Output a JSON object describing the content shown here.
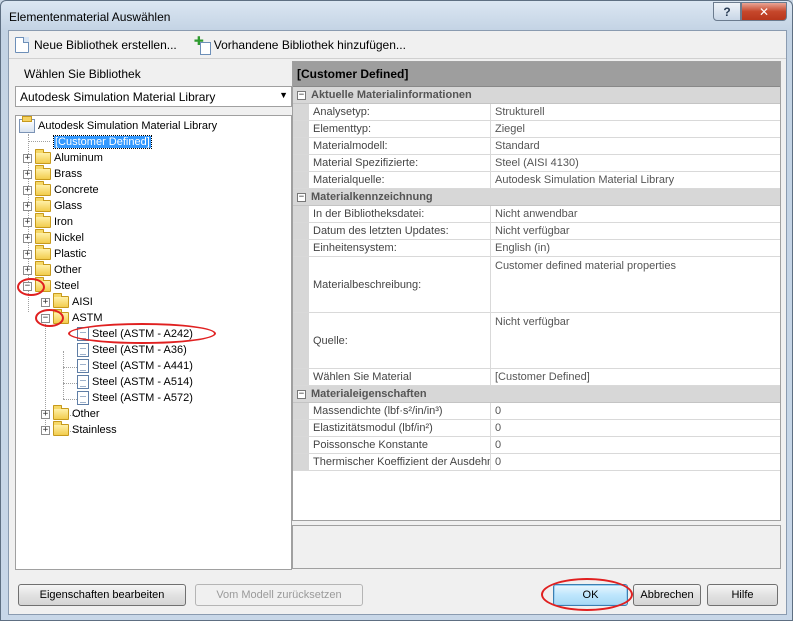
{
  "window": {
    "title": "Elementenmaterial Auswählen",
    "help": "?",
    "close": "✕"
  },
  "toolbar": {
    "new_library": "Neue Bibliothek erstellen...",
    "add_library": "Vorhandene Bibliothek hinzufügen..."
  },
  "library": {
    "label": "Wählen Sie Bibliothek",
    "selected": "Autodesk Simulation Material Library"
  },
  "tree": {
    "root": "Autodesk Simulation Material Library",
    "custom": "[Customer Defined]",
    "folders": [
      "Aluminum",
      "Brass",
      "Concrete",
      "Glass",
      "Iron",
      "Nickel",
      "Plastic",
      "Other",
      "Steel"
    ],
    "steel_children": {
      "aisi": "AISI",
      "astm": "ASTM",
      "other": "Other",
      "stainless": "Stainless"
    },
    "astm_items": [
      "Steel (ASTM - A242)",
      "Steel (ASTM - A36)",
      "Steel (ASTM - A441)",
      "Steel (ASTM - A514)",
      "Steel (ASTM - A572)"
    ]
  },
  "properties": {
    "header": "[Customer Defined]",
    "cat1": "Aktuelle Materialinformationen",
    "cat1_rows": [
      {
        "k": "Analysetyp:",
        "v": "Strukturell"
      },
      {
        "k": "Elementtyp:",
        "v": "Ziegel"
      },
      {
        "k": "Materialmodell:",
        "v": "Standard"
      },
      {
        "k": "Material Spezifizierte:",
        "v": "Steel (AISI 4130)"
      },
      {
        "k": "Materialquelle:",
        "v": "Autodesk Simulation Material Library"
      }
    ],
    "cat2": "Materialkennzeichnung",
    "cat2_rows": [
      {
        "k": "In der Bibliotheksdatei:",
        "v": "Nicht anwendbar"
      },
      {
        "k": "Datum des letzten Updates:",
        "v": "Nicht verfügbar"
      },
      {
        "k": "Einheitensystem:",
        "v": "English (in)"
      }
    ],
    "desc": {
      "k": "Materialbeschreibung:",
      "v": "Customer defined material properties"
    },
    "source": {
      "k": "Quelle:",
      "v": "Nicht verfügbar"
    },
    "chosen": {
      "k": "Wählen Sie Material",
      "v": "[Customer Defined]"
    },
    "cat3": "Materialeigenschaften",
    "cat3_rows": [
      {
        "k": "Massendichte (lbf·s²/in/in³)",
        "v": "0"
      },
      {
        "k": "Elastizitätsmodul (lbf/in²)",
        "v": "0"
      },
      {
        "k": "Poissonsche Konstante",
        "v": "0"
      },
      {
        "k": "Thermischer Koeffizient der Ausdehnung",
        "v": "0"
      }
    ]
  },
  "buttons": {
    "edit": "Eigenschaften bearbeiten",
    "reset": "Vom Modell zurücksetzen",
    "ok": "OK",
    "cancel": "Abbrechen",
    "help": "Hilfe"
  }
}
